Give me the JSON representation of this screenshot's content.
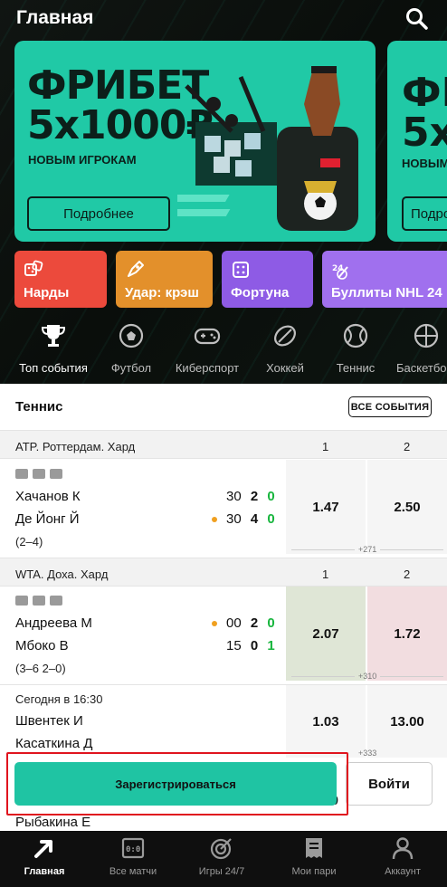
{
  "header": {
    "title": "Главная"
  },
  "banners": [
    {
      "title": "ФРИБЕТ\n5x1000₽",
      "subtitle": "НОВЫМ ИГРОКАМ",
      "button": "Подробнее"
    },
    {
      "title": "ФР\n5x",
      "subtitle": "НОВЫМ",
      "button": "Подро"
    }
  ],
  "tiles": [
    {
      "label": "Нарды",
      "color": "#ec4a3c"
    },
    {
      "label": "Удар: крэш",
      "color": "#e3902b"
    },
    {
      "label": "Фортуна",
      "color": "#8e5be5"
    },
    {
      "label": "Буллиты NHL 24",
      "color": "#a070ee"
    }
  ],
  "sports": [
    {
      "label": "Топ события",
      "icon": "trophy-icon"
    },
    {
      "label": "Футбол",
      "icon": "soccer-ball-icon"
    },
    {
      "label": "Киберспорт",
      "icon": "gamepad-icon"
    },
    {
      "label": "Хоккей",
      "icon": "hockey-puck-icon"
    },
    {
      "label": "Теннис",
      "icon": "tennis-ball-icon"
    },
    {
      "label": "Баскетбо",
      "icon": "basketball-icon"
    }
  ],
  "section": {
    "title": "Теннис",
    "all_events": "ВСЕ СОБЫТИЯ"
  },
  "leagues": [
    {
      "name": "ATP. Роттердам. Хард",
      "col1": "1",
      "col2": "2"
    },
    {
      "name": "WTA. Доха. Хард",
      "col1": "1",
      "col2": "2"
    }
  ],
  "matches": [
    {
      "player1": "Хачанов К",
      "player2": "Де Йонг Й",
      "sets": "(2–4)",
      "p1_points": "30",
      "p1_games": "2",
      "p1_sets": "0",
      "p2_points": "30",
      "p2_games": "4",
      "p2_sets": "0",
      "odd1": "1.47",
      "odd2": "2.50",
      "more": "+271"
    },
    {
      "player1": "Андреева М",
      "player2": "Мбоко В",
      "sets": "(3–6 2–0)",
      "p1_points": "00",
      "p1_games": "2",
      "p1_sets": "0",
      "p2_points": "15",
      "p2_games": "0",
      "p2_sets": "1",
      "odd1": "2.07",
      "odd2": "1.72",
      "more": "+310"
    },
    {
      "time": "Сегодня в 16:30",
      "player1": "Швентек И",
      "player2": "Касаткина Д",
      "odd1": "1.03",
      "odd2": "13.00",
      "more": "+333"
    },
    {
      "player2": "Рыбакина Е",
      "odd1_partial": "0"
    }
  ],
  "cta": {
    "register": "Зарегистрироваться",
    "login": "Войти"
  },
  "nav": [
    {
      "label": "Главная",
      "icon": "arrow-icon"
    },
    {
      "label": "Все матчи",
      "icon": "scoreboard-icon"
    },
    {
      "label": "Игры 24/7",
      "icon": "target-icon"
    },
    {
      "label": "Мои пари",
      "icon": "receipt-icon"
    },
    {
      "label": "Аккаунт",
      "icon": "user-icon"
    }
  ]
}
